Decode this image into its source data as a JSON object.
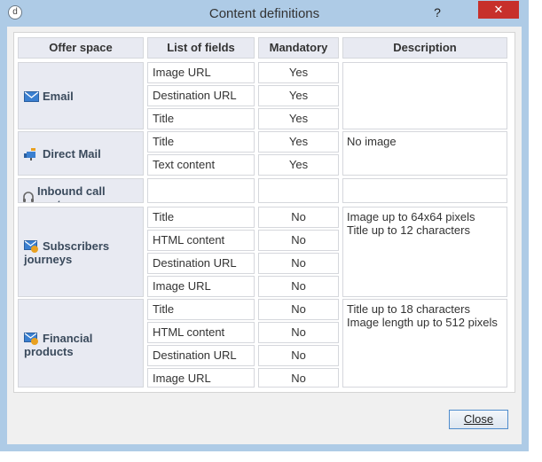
{
  "window": {
    "title": "Content definitions",
    "help": "?",
    "close_glyph": "✕",
    "app_icon": "d"
  },
  "table": {
    "headers": {
      "offer_space": "Offer space",
      "fields": "List of fields",
      "mandatory": "Mandatory",
      "description": "Description"
    },
    "groups": [
      {
        "name": "Email",
        "icon": "email-icon",
        "rows": [
          {
            "field": "Image URL",
            "mandatory": "Yes"
          },
          {
            "field": "Destination URL",
            "mandatory": "Yes"
          },
          {
            "field": "Title",
            "mandatory": "Yes"
          }
        ],
        "description": [
          "",
          ""
        ]
      },
      {
        "name": "Direct Mail",
        "icon": "direct-mail-icon",
        "rows": [
          {
            "field": "Title",
            "mandatory": "Yes"
          },
          {
            "field": "Text content",
            "mandatory": "Yes"
          }
        ],
        "description": [
          "No image",
          ""
        ]
      },
      {
        "name": "Inbound call center",
        "icon": "headset-icon",
        "rows": [
          {
            "field": "",
            "mandatory": ""
          }
        ],
        "description": [
          "",
          ""
        ]
      },
      {
        "name_line1": "Subscribers",
        "name_line2": "journeys",
        "icon": "subscribers-journeys-icon",
        "rows": [
          {
            "field": "Title",
            "mandatory": "No"
          },
          {
            "field": "HTML content",
            "mandatory": "No"
          },
          {
            "field": "Destination URL",
            "mandatory": "No"
          },
          {
            "field": "Image URL",
            "mandatory": "No"
          }
        ],
        "description": [
          "Image up to 64x64 pixels",
          "Title up to 12 characters"
        ]
      },
      {
        "name_line1": "Financial",
        "name_line2": "products",
        "icon": "financial-products-icon",
        "rows": [
          {
            "field": "Title",
            "mandatory": "No"
          },
          {
            "field": "HTML content",
            "mandatory": "No"
          },
          {
            "field": "Destination URL",
            "mandatory": "No"
          },
          {
            "field": "Image URL",
            "mandatory": "No"
          }
        ],
        "description": [
          "Title up to 18 characters",
          "Image length up to 512 pixels"
        ]
      }
    ]
  },
  "footer": {
    "close_label": "Close"
  },
  "colors": {
    "titlebar": "#aecbe6",
    "close_button": "#c7302b",
    "header_bg": "#e8eaf2",
    "offer_text": "#3a4a5c"
  }
}
